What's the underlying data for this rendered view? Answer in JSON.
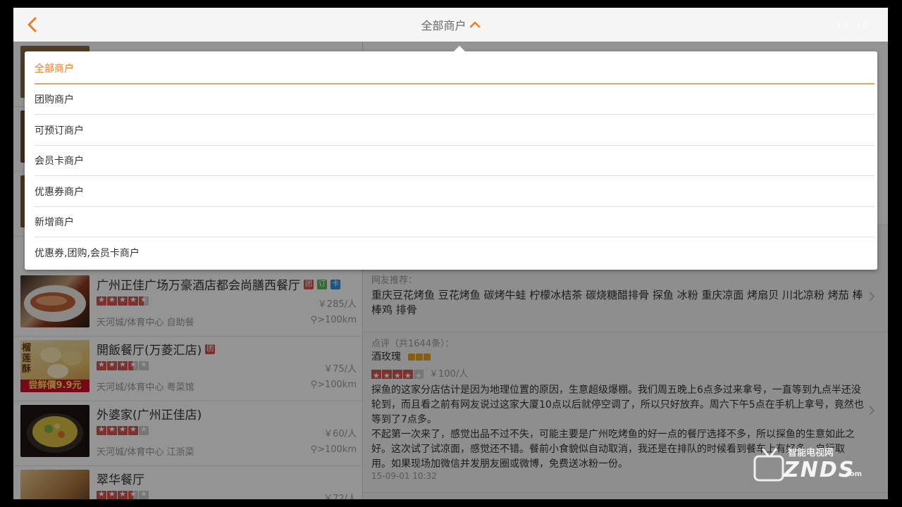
{
  "header": {
    "title": "全部商户",
    "time": "11:12"
  },
  "dropdown": {
    "options": [
      "全部商户",
      "团购商户",
      "可预订商户",
      "会员卡商户",
      "优惠券商户",
      "新增商户",
      "优惠券,团购,会员卡商户"
    ],
    "selected": "全部商户"
  },
  "list": {
    "items": [
      {
        "name": "广州正佳广场万豪酒店都会尚膳西餐厅",
        "tags": [
          "团",
          "订",
          "卡"
        ],
        "rating": 4.5,
        "price": "￥285/人",
        "area": "天河城/体育中心 自助餐",
        "distance": ">100km"
      },
      {
        "name": "開飯餐厅(万菱汇店)",
        "tags": [
          "团"
        ],
        "rating": 3.5,
        "price": "￥75/人",
        "area": "天河城/体育中心 粤菜馆",
        "distance": ">100km",
        "thumb_text": "尝鲜價9.9元",
        "thumb_side": "榴莲酥"
      },
      {
        "name": "外婆家(广州正佳店)",
        "tags": [],
        "rating": 4,
        "price": "￥60/人",
        "area": "天河城/体育中心 江浙菜",
        "distance": ">100km"
      },
      {
        "name": "翠华餐厅",
        "tags": [],
        "rating": 3.5,
        "price": "￥72/人",
        "area": "",
        "distance": ""
      }
    ]
  },
  "detail": {
    "recommend_label": "网友推荐：",
    "recommend_text": "重庆豆花烤鱼 豆花烤鱼 碳烤牛蛙 柠檬冰桔茶 碳烧糖醋排骨 探鱼 冰粉 重庆凉面 烤扇贝 川北凉粉 烤茄 棒棒鸡 排骨",
    "review_label": "点评（共1644条）：",
    "reviewer": "酒玫瑰",
    "review_rating": 4,
    "review_price": "￥100/人",
    "review_text_1": "探鱼的这家分店估计是因为地理位置的原因，生意超级爆棚。我们周五晚上6点多过来拿号，一直等到九点半还没轮到，而且看之前有网友说过这家大厦10点以后就停空调了，所以只好放弃。周六下午5点在手机上拿号，竟然也等到了7点多。",
    "review_text_2": "不起第一次来了，感觉出品不过不失，可能主要是广州吃烤鱼的好一点的餐厅选择不多，所以探鱼的生意如此之好。这次试了试凉面，感觉还不错。餐前小食貌似自动取消，我还是在排队的时候看到餐车上有好多，自行取用。如果现场加微信并发朋友圈或微博，免费送冰粉一份。",
    "review_time": "15-09-01 10:32"
  },
  "watermark": {
    "cn": "智能电视网",
    "logo": "ZNDS",
    "suffix": ".com"
  },
  "colors": {
    "accent": "#f07b22",
    "star": "#d9534f"
  }
}
